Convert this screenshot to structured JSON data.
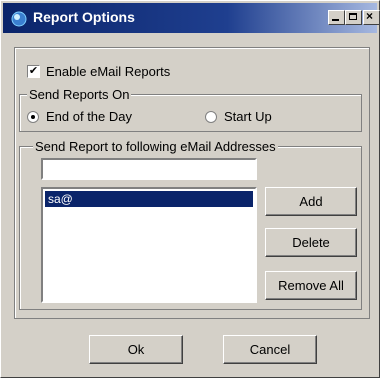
{
  "window": {
    "title": "Report Options"
  },
  "options": {
    "enable_email_checked": true,
    "enable_email_label": "Enable eMail Reports"
  },
  "send_reports_on": {
    "legend": "Send Reports On",
    "options": [
      {
        "label": "End of the Day",
        "selected": true
      },
      {
        "label": "Start Up",
        "selected": false
      }
    ]
  },
  "email_group": {
    "legend": "Send Report to following eMail Addresses",
    "input_value": "",
    "list_items": [
      "sa@"
    ],
    "buttons": {
      "add": "Add",
      "delete": "Delete",
      "remove_all": "Remove All"
    }
  },
  "footer": {
    "ok": "Ok",
    "cancel": "Cancel"
  }
}
